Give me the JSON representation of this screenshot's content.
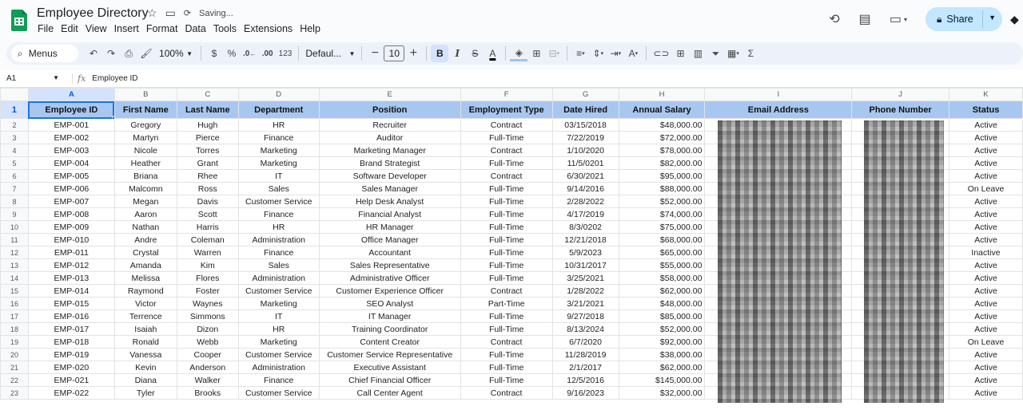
{
  "app": {
    "doc_title": "Employee Directory",
    "saving_text": "Saving...",
    "menu": [
      "File",
      "Edit",
      "View",
      "Insert",
      "Format",
      "Data",
      "Tools",
      "Extensions",
      "Help"
    ],
    "share_label": "Share",
    "accent": "#0f9d58"
  },
  "toolbar": {
    "menus_label": "Menus",
    "zoom": "100%",
    "currency": "$",
    "percent": "%",
    "dec_decrease": ".0←",
    "dec_increase": ".00",
    "number_format": "123",
    "font_name": "Defaul...",
    "font_size": "10",
    "bold": "B",
    "italic": "I",
    "strike": "S",
    "text_color": "A"
  },
  "formula_bar": {
    "cell_ref": "A1",
    "fx": "fx",
    "content": "Employee ID"
  },
  "sheet": {
    "columns": [
      "A",
      "B",
      "C",
      "D",
      "E",
      "F",
      "G",
      "H",
      "I",
      "J",
      "K"
    ],
    "headers": [
      "Employee ID",
      "First Name",
      "Last Name",
      "Department",
      "Position",
      "Employment Type",
      "Date Hired",
      "Annual Salary",
      "Email Address",
      "Phone Number",
      "Status"
    ],
    "rows": [
      [
        "EMP-001",
        "Gregory",
        "Hugh",
        "HR",
        "Recruiter",
        "Contract",
        "03/15/2018",
        "$48,000.00",
        "",
        "",
        "Active"
      ],
      [
        "EMP-002",
        "Martyn",
        "Pierce",
        "Finance",
        "Auditor",
        "Full-Time",
        "7/22/2019",
        "$72,000.00",
        "",
        "",
        "Active"
      ],
      [
        "EMP-003",
        "Nicole",
        "Torres",
        "Marketing",
        "Marketing Manager",
        "Contract",
        "1/10/2020",
        "$78,000.00",
        "",
        "",
        "Active"
      ],
      [
        "EMP-004",
        "Heather",
        "Grant",
        "Marketing",
        "Brand Strategist",
        "Full-Time",
        "11/5/0201",
        "$82,000.00",
        "",
        "",
        "Active"
      ],
      [
        "EMP-005",
        "Briana",
        "Rhee",
        "IT",
        "Software Developer",
        "Contract",
        "6/30/2021",
        "$95,000.00",
        "",
        "",
        "Active"
      ],
      [
        "EMP-006",
        "Malcomn",
        "Ross",
        "Sales",
        "Sales Manager",
        "Full-Time",
        "9/14/2016",
        "$88,000.00",
        "",
        "",
        "On Leave"
      ],
      [
        "EMP-007",
        "Megan",
        "Davis",
        "Customer Service",
        "Help Desk Analyst",
        "Full-Time",
        "2/28/2022",
        "$52,000.00",
        "",
        "",
        "Active"
      ],
      [
        "EMP-008",
        "Aaron",
        "Scott",
        "Finance",
        "Financial Analyst",
        "Full-Time",
        "4/17/2019",
        "$74,000.00",
        "",
        "",
        "Active"
      ],
      [
        "EMP-009",
        "Nathan",
        "Harris",
        "HR",
        "HR Manager",
        "Full-Time",
        "8/3/0202",
        "$75,000.00",
        "",
        "",
        "Active"
      ],
      [
        "EMP-010",
        "Andre",
        "Coleman",
        "Administration",
        "Office Manager",
        "Full-Time",
        "12/21/2018",
        "$68,000.00",
        "",
        "",
        "Active"
      ],
      [
        "EMP-011",
        "Crystal",
        "Warren",
        "Finance",
        "Accountant",
        "Full-Time",
        "5/9/2023",
        "$65,000.00",
        "",
        "",
        "Inactive"
      ],
      [
        "EMP-012",
        "Amanda",
        "Kim",
        "Sales",
        "Sales Representative",
        "Full-Time",
        "10/31/2017",
        "$55,000.00",
        "",
        "",
        "Active"
      ],
      [
        "EMP-013",
        "Melissa",
        "Flores",
        "Administration",
        "Administrative Officer",
        "Full-Time",
        "3/25/2021",
        "$58,000.00",
        "",
        "",
        "Active"
      ],
      [
        "EMP-014",
        "Raymond",
        "Foster",
        "Customer Service",
        "Customer Experience Officer",
        "Contract",
        "1/28/2022",
        "$62,000.00",
        "",
        "",
        "Active"
      ],
      [
        "EMP-015",
        "Victor",
        "Waynes",
        "Marketing",
        "SEO Analyst",
        "Part-Time",
        "3/21/2021",
        "$48,000.00",
        "",
        "",
        "Active"
      ],
      [
        "EMP-016",
        "Terrence",
        "Simmons",
        "IT",
        "IT Manager",
        "Full-Time",
        "9/27/2018",
        "$85,000.00",
        "",
        "",
        "Active"
      ],
      [
        "EMP-017",
        "Isaiah",
        "Dizon",
        "HR",
        "Training Coordinator",
        "Full-Time",
        "8/13/2024",
        "$52,000.00",
        "",
        "",
        "Active"
      ],
      [
        "EMP-018",
        "Ronald",
        "Webb",
        "Marketing",
        "Content Creator",
        "Contract",
        "6/7/2020",
        "$92,000.00",
        "",
        "",
        "On Leave"
      ],
      [
        "EMP-019",
        "Vanessa",
        "Cooper",
        "Customer Service",
        "Customer Service Representative",
        "Full-Time",
        "11/28/2019",
        "$38,000.00",
        "",
        "",
        "Active"
      ],
      [
        "EMP-020",
        "Kevin",
        "Anderson",
        "Administration",
        "Executive Assistant",
        "Full-Time",
        "2/1/2017",
        "$62,000.00",
        "",
        "",
        "Active"
      ],
      [
        "EMP-021",
        "Diana",
        "Walker",
        "Finance",
        "Chief Financial Officer",
        "Full-Time",
        "12/5/2016",
        "$145,000.00",
        "",
        "",
        "Active"
      ],
      [
        "EMP-022",
        "Tyler",
        "Brooks",
        "Customer Service",
        "Call Center Agent",
        "Contract",
        "9/16/2023",
        "$32,000.00",
        "",
        "",
        "Active"
      ]
    ]
  }
}
